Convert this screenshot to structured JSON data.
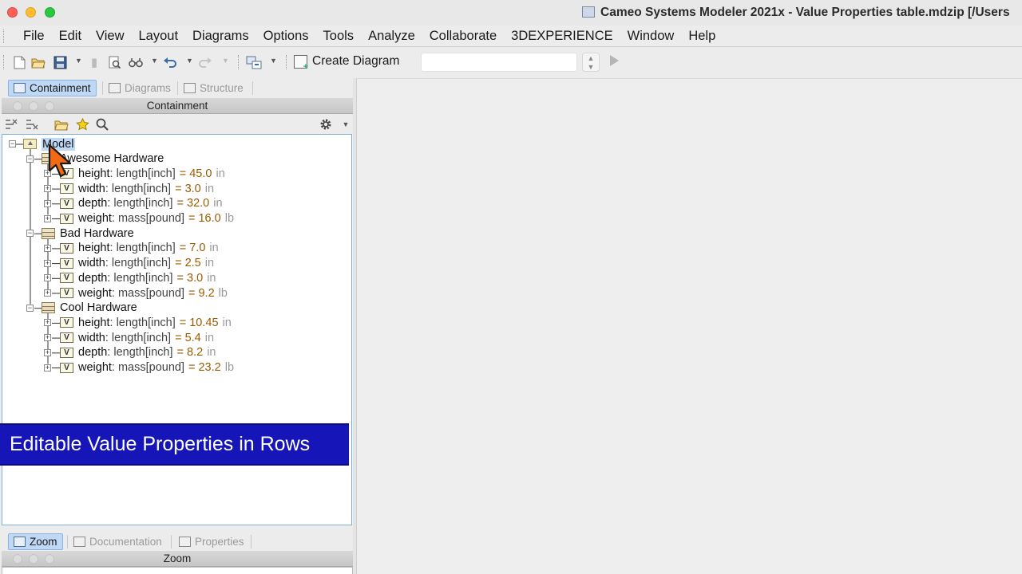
{
  "window": {
    "title": "Cameo Systems Modeler 2021x - Value Properties table.mdzip [/Users"
  },
  "menu": [
    "File",
    "Edit",
    "View",
    "Layout",
    "Diagrams",
    "Options",
    "Tools",
    "Analyze",
    "Collaborate",
    "3DEXPERIENCE",
    "Window",
    "Help"
  ],
  "toolbar": {
    "create_diagram_label": "Create Diagram",
    "combo_value": ""
  },
  "left_tabs": {
    "containment": "Containment",
    "diagrams": "Diagrams",
    "structure": "Structure"
  },
  "panel": {
    "title": "Containment"
  },
  "tree": {
    "root": "Model",
    "blocks": [
      {
        "name": "Awesome Hardware",
        "properties": [
          {
            "name": "height",
            "type": " : length[inch]",
            "value": "= 45.0",
            "unit": "in"
          },
          {
            "name": "width",
            "type": " : length[inch]",
            "value": "= 3.0",
            "unit": "in"
          },
          {
            "name": "depth",
            "type": " : length[inch]",
            "value": "= 32.0",
            "unit": "in"
          },
          {
            "name": "weight",
            "type": " : mass[pound]",
            "value": "= 16.0",
            "unit": "lb"
          }
        ]
      },
      {
        "name": "Bad Hardware",
        "properties": [
          {
            "name": "height",
            "type": " : length[inch]",
            "value": "= 7.0",
            "unit": "in"
          },
          {
            "name": "width",
            "type": " : length[inch]",
            "value": "= 2.5",
            "unit": "in"
          },
          {
            "name": "depth",
            "type": " : length[inch]",
            "value": "= 3.0",
            "unit": "in"
          },
          {
            "name": "weight",
            "type": " : mass[pound]",
            "value": "= 9.2",
            "unit": "lb"
          }
        ]
      },
      {
        "name": "Cool Hardware",
        "properties": [
          {
            "name": "height",
            "type": " : length[inch]",
            "value": "= 10.45",
            "unit": "in"
          },
          {
            "name": "width",
            "type": " : length[inch]",
            "value": "= 5.4",
            "unit": "in"
          },
          {
            "name": "depth",
            "type": " : length[inch]",
            "value": "= 8.2",
            "unit": "in"
          },
          {
            "name": "weight",
            "type": " : mass[pound]",
            "value": "= 23.2",
            "unit": "lb"
          }
        ]
      }
    ]
  },
  "caption": "Editable Value Properties in Rows",
  "bottom_tabs": {
    "zoom": "Zoom",
    "documentation": "Documentation",
    "properties": "Properties"
  },
  "zoom_panel": {
    "title": "Zoom"
  },
  "colors": {
    "selection": "#bfd8f5",
    "caption_bg": "#1616b8",
    "value_text": "#9a5a00",
    "cursor": "#f26a12"
  },
  "icons": {
    "new": "new-file-icon",
    "open": "open-folder-icon",
    "save": "save-icon",
    "undo": "undo-icon",
    "redo": "redo-icon",
    "settings": "gear-icon",
    "search": "search-icon",
    "favorite": "star-icon"
  }
}
